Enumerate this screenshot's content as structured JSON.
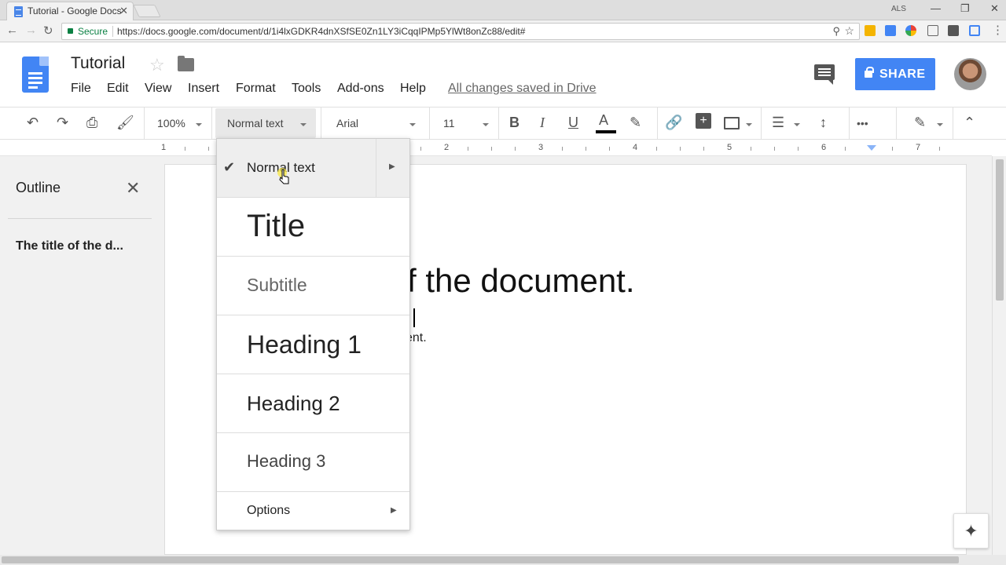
{
  "browser": {
    "tab_title": "Tutorial - Google Docs",
    "tab_close": "✕",
    "secure_label": "Secure",
    "url": "https://docs.google.com/document/d/1i4lxGDKR4dnXSfSE0Zn1LY3iCqqIPMp5YlWt8onZc88/edit#",
    "profile_label": "ALS"
  },
  "docs": {
    "title": "Tutorial",
    "menus": [
      "File",
      "Edit",
      "View",
      "Insert",
      "Format",
      "Tools",
      "Add-ons",
      "Help"
    ],
    "save_status": "All changes saved in Drive",
    "share_label": "SHARE"
  },
  "toolbar": {
    "zoom": "100%",
    "style": "Normal text",
    "font": "Arial",
    "font_size": "11",
    "bold": "B",
    "italic": "I",
    "underline": "U",
    "text_color_label": "A",
    "more": "•••"
  },
  "ruler": {
    "numbers": [
      "1",
      "1",
      "2",
      "3",
      "4",
      "5",
      "6",
      "7"
    ]
  },
  "outline": {
    "title": "Outline",
    "items": [
      "The title of the d..."
    ]
  },
  "document": {
    "title_visible": "f the document.",
    "subline_visible": "ent."
  },
  "styles_menu": {
    "items": [
      "Normal text",
      "Title",
      "Subtitle",
      "Heading 1",
      "Heading 2",
      "Heading 3",
      "Options"
    ],
    "selected": "Normal text"
  },
  "colors": {
    "accent": "#4285f4",
    "secure": "#0b8043"
  }
}
